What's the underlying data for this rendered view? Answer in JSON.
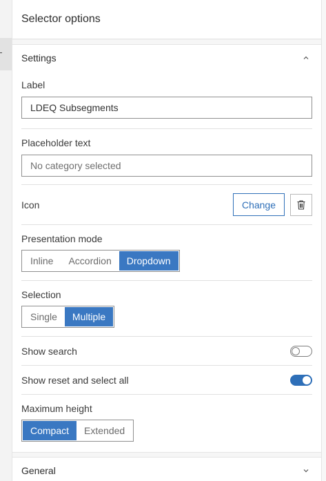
{
  "header": {
    "title": "Selector options"
  },
  "settings": {
    "section_title": "Settings",
    "label_field": {
      "label": "Label",
      "value": "LDEQ Subsegments"
    },
    "placeholder_field": {
      "label": "Placeholder text",
      "placeholder": "No category selected"
    },
    "icon": {
      "label": "Icon",
      "change_label": "Change"
    },
    "presentation_mode": {
      "label": "Presentation mode",
      "options": [
        "Inline",
        "Accordion",
        "Dropdown"
      ],
      "selected": "Dropdown"
    },
    "selection": {
      "label": "Selection",
      "options": [
        "Single",
        "Multiple"
      ],
      "selected": "Multiple"
    },
    "show_search": {
      "label": "Show search",
      "on": false
    },
    "show_reset": {
      "label": "Show reset and select all",
      "on": true
    },
    "max_height": {
      "label": "Maximum height",
      "options": [
        "Compact",
        "Extended"
      ],
      "selected": "Compact"
    }
  },
  "general": {
    "section_title": "General"
  },
  "icons": {
    "collapse": "chevron-up-icon",
    "expand": "chevron-down-icon",
    "delete": "trash-icon"
  },
  "colors": {
    "accent": "#3a78c2",
    "button_border": "#2e6fb8"
  }
}
